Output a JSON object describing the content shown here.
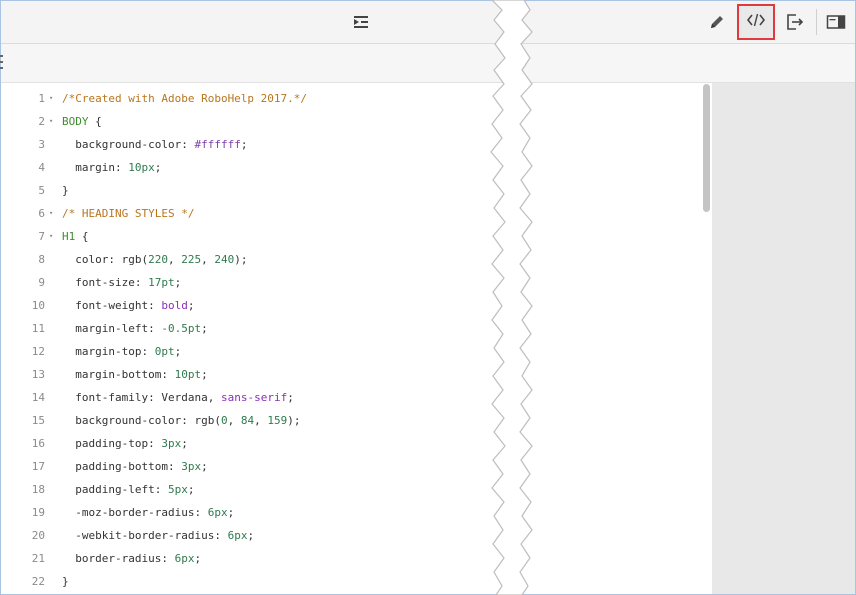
{
  "toolbar": {
    "icons": {
      "indent": "indent-icon",
      "edit": "pencil-icon",
      "code_view": "code-view-icon",
      "export": "export-icon",
      "panel": "panel-toggle-icon"
    },
    "highlight_color": "#e0393e"
  },
  "editor": {
    "lines": [
      {
        "n": "1",
        "fold": "▾",
        "text": "/*Created with Adobe RoboHelp 2017.*/"
      },
      {
        "n": "2",
        "fold": "▾",
        "text": "BODY {"
      },
      {
        "n": "3",
        "fold": "",
        "text": "  background-color: #ffffff;"
      },
      {
        "n": "4",
        "fold": "",
        "text": "  margin: 10px;"
      },
      {
        "n": "5",
        "fold": "",
        "text": "}"
      },
      {
        "n": "6",
        "fold": "▾",
        "text": "/* HEADING STYLES */"
      },
      {
        "n": "7",
        "fold": "▾",
        "text": "H1 {"
      },
      {
        "n": "8",
        "fold": "",
        "text": "  color: rgb(220, 225, 240);"
      },
      {
        "n": "9",
        "fold": "",
        "text": "  font-size: 17pt;"
      },
      {
        "n": "10",
        "fold": "",
        "text": "  font-weight: bold;"
      },
      {
        "n": "11",
        "fold": "",
        "text": "  margin-left: -0.5pt;"
      },
      {
        "n": "12",
        "fold": "",
        "text": "  margin-top: 0pt;"
      },
      {
        "n": "13",
        "fold": "",
        "text": "  margin-bottom: 10pt;"
      },
      {
        "n": "14",
        "fold": "",
        "text": "  font-family: Verdana, sans-serif;"
      },
      {
        "n": "15",
        "fold": "",
        "text": "  background-color: rgb(0, 84, 159);"
      },
      {
        "n": "16",
        "fold": "",
        "text": "  padding-top: 3px;"
      },
      {
        "n": "17",
        "fold": "",
        "text": "  padding-bottom: 3px;"
      },
      {
        "n": "18",
        "fold": "",
        "text": "  padding-left: 5px;"
      },
      {
        "n": "19",
        "fold": "",
        "text": "  -moz-border-radius: 6px;"
      },
      {
        "n": "20",
        "fold": "",
        "text": "  -webkit-border-radius: 6px;"
      },
      {
        "n": "21",
        "fold": "",
        "text": "  border-radius: 6px;"
      },
      {
        "n": "22",
        "fold": "",
        "text": "}"
      }
    ]
  }
}
